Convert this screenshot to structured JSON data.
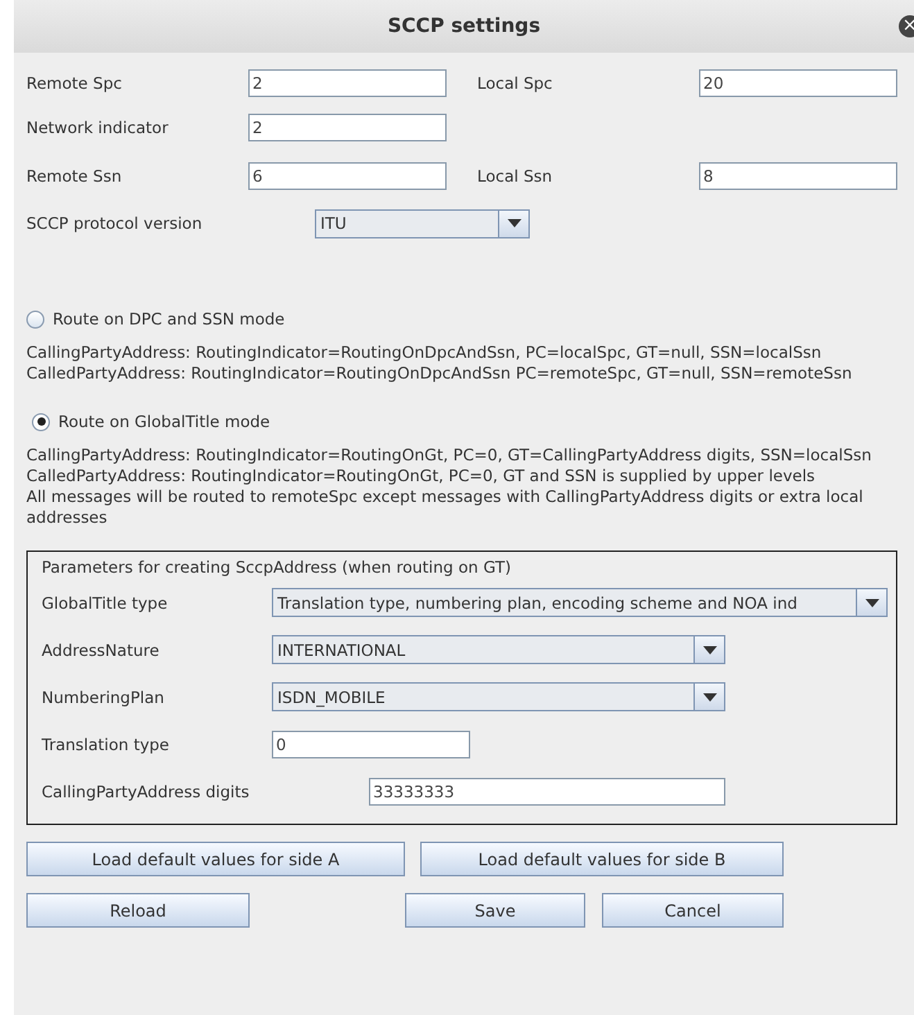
{
  "window": {
    "title": "SCCP settings",
    "close": "×"
  },
  "fields": [
    {
      "label": "Remote Spc",
      "value": "2"
    },
    {
      "label": "Local Spc",
      "value": "20"
    },
    {
      "label": "Network indicator",
      "value": "2"
    },
    {
      "label": "Remote Ssn",
      "value": "6"
    },
    {
      "label": "Local Ssn",
      "value": "8"
    }
  ],
  "protocol": {
    "label": "SCCP protocol version",
    "value": "ITU"
  },
  "modes": [
    {
      "label": "Route on DPC and SSN mode",
      "selected": false,
      "description": [
        "CallingPartyAddress: RoutingIndicator=RoutingOnDpcAndSsn, PC=localSpc, GT=null, SSN=localSsn",
        "CalledPartyAddress: RoutingIndicator=RoutingOnDpcAndSsn PC=remoteSpc, GT=null, SSN=remoteSsn"
      ]
    },
    {
      "label": "Route on GlobalTitle mode",
      "selected": true,
      "description": [
        "CallingPartyAddress: RoutingIndicator=RoutingOnGt, PC=0, GT=CallingPartyAddress digits, SSN=localSsn",
        "CalledPartyAddress: RoutingIndicator=RoutingOnGt, PC=0, GT and SSN is supplied by upper levels",
        "All messages will be routed to remoteSpc except messages with CallingPartyAddress digits or extra local addresses"
      ]
    }
  ],
  "group": {
    "title": "Parameters for creating SccpAddress (when routing on GT)",
    "rows": [
      {
        "kind": "dropdown",
        "label": "GlobalTitle type",
        "value": "Translation type, numbering plan, encoding scheme and NOA ind"
      },
      {
        "kind": "dropdown",
        "label": "AddressNature",
        "value": "INTERNATIONAL"
      },
      {
        "kind": "dropdown",
        "label": "NumberingPlan",
        "value": "ISDN_MOBILE"
      },
      {
        "kind": "text",
        "label": "Translation type",
        "value": "0"
      },
      {
        "kind": "text",
        "label": "CallingPartyAddress digits",
        "value": "33333333"
      }
    ]
  },
  "buttons": [
    "Load default values for side A",
    "Load default values for side B",
    "Reload",
    "Save",
    "Cancel"
  ]
}
